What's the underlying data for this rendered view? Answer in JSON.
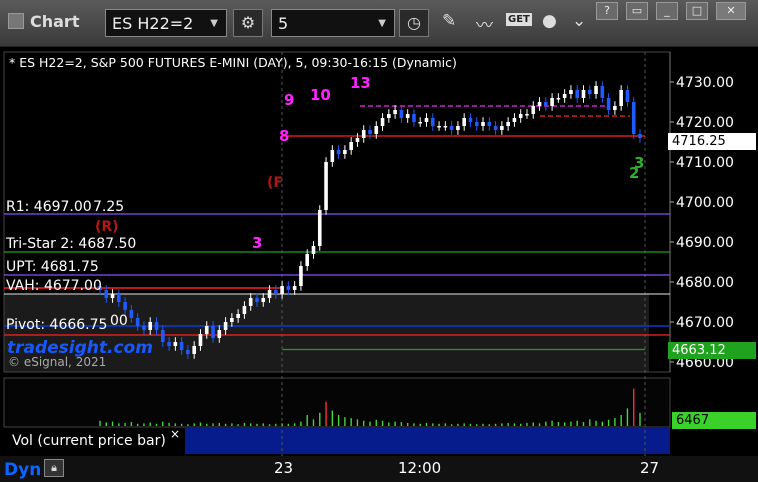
{
  "toolbar": {
    "app_title": "Chart",
    "symbol": "ES H22=2",
    "interval": "5",
    "get_label": "GET"
  },
  "chart_info": "* ES H22=2, S&P 500 FUTURES E-MINI (DAY), 5, 09:30-16:15 (Dynamic)",
  "overlay_labels": {
    "r1": "R1: 4697.00",
    "r1_suffix": "7.25",
    "tristar": "Tri-Star 2: 4687.50",
    "upt": "UPT: 4681.75",
    "vah": "VAH: 4677.00",
    "pivot": "Pivot: 4666.75",
    "pivot_suffix": "00",
    "r_marker": "(R)",
    "f_marker": "(F"
  },
  "watermark": {
    "brand": "tradesight.com",
    "copyright": "© eSignal, 2021"
  },
  "volume_panel": {
    "title": "Vol (current price bar)",
    "close": "×",
    "last_volume": "6467"
  },
  "bottom_bar": {
    "mode": "Dyn"
  },
  "price_tags": {
    "last": "4716.25",
    "level": "4663.12"
  },
  "td_counts": [
    "8",
    "9",
    "10",
    "13",
    "3",
    "2",
    "3"
  ],
  "colors": {
    "up_candle": "#ffffff",
    "down_candle": "#1f5aff",
    "resistance": "#ff2020",
    "support": "#1aa01a",
    "pivot_purple": "#8a4cff",
    "counts_magenta": "#ff22ff",
    "counts_green": "#2fae2f"
  },
  "chart_data": {
    "type": "candlestick",
    "symbol": "ES H22=2",
    "yaxis": {
      "ticks": [
        4660,
        4670,
        4680,
        4690,
        4700,
        4710,
        4720,
        4730
      ],
      "tick_labels": [
        "4660.00",
        "4670.00",
        "4680.00",
        "4690.00",
        "4700.00",
        "4710.00",
        "4720.00",
        "4730.00"
      ],
      "ylim": [
        4657.5,
        4737.5
      ]
    },
    "xaxis": {
      "tick_labels": [
        "23",
        "12:00",
        "27"
      ]
    },
    "levels": [
      {
        "name": "R1",
        "value": 4697.0
      },
      {
        "name": "Tri-Star 2",
        "value": 4687.5
      },
      {
        "name": "UPT",
        "value": 4681.75
      },
      {
        "name": "VAH",
        "value": 4677.0
      },
      {
        "name": "Pivot",
        "value": 4666.75
      },
      {
        "name": "Resistance",
        "value": 4716.5
      },
      {
        "name": "Support",
        "value": 4663.12
      }
    ],
    "closes": [
      4678,
      4676,
      4677,
      4675,
      4673,
      4671,
      4669,
      4668,
      4670,
      4668,
      4665,
      4664,
      4665,
      4663,
      4662,
      4664,
      4667,
      4669,
      4666,
      4668,
      4670,
      4671,
      4672,
      4674,
      4676,
      4675,
      4676,
      4678,
      4677,
      4679,
      4678,
      4679,
      4684,
      4687,
      4689,
      4698,
      4710,
      4713,
      4712,
      4713,
      4715,
      4716,
      4718,
      4717,
      4719,
      4721,
      4722,
      4723,
      4721,
      4722,
      4720,
      4720,
      4721,
      4719,
      4719,
      4719,
      4718,
      4719,
      4721,
      4720,
      4719,
      4720,
      4719,
      4718,
      4719,
      4720,
      4721,
      4722,
      4722,
      4724,
      4725,
      4724,
      4726,
      4726,
      4727,
      4728,
      4726,
      4728,
      4727,
      4729,
      4726,
      4723,
      4724,
      4728,
      4725,
      4717,
      4716
    ],
    "volume": {
      "last": 6467,
      "values": [
        0.12,
        0.08,
        0.1,
        0.06,
        0.07,
        0.09,
        0.05,
        0.06,
        0.08,
        0.05,
        0.1,
        0.07,
        0.06,
        0.05,
        0.04,
        0.06,
        0.08,
        0.05,
        0.06,
        0.07,
        0.05,
        0.06,
        0.04,
        0.07,
        0.06,
        0.05,
        0.06,
        0.04,
        0.05,
        0.06,
        0.05,
        0.06,
        0.1,
        0.25,
        0.15,
        0.3,
        0.55,
        0.35,
        0.25,
        0.2,
        0.18,
        0.15,
        0.12,
        0.1,
        0.14,
        0.12,
        0.08,
        0.1,
        0.09,
        0.07,
        0.06,
        0.05,
        0.07,
        0.06,
        0.05,
        0.06,
        0.04,
        0.05,
        0.06,
        0.05,
        0.04,
        0.05,
        0.04,
        0.05,
        0.06,
        0.07,
        0.06,
        0.05,
        0.07,
        0.08,
        0.06,
        0.1,
        0.12,
        0.09,
        0.08,
        0.1,
        0.12,
        0.09,
        0.15,
        0.12,
        0.1,
        0.14,
        0.18,
        0.25,
        0.4,
        0.85,
        0.3
      ]
    }
  }
}
